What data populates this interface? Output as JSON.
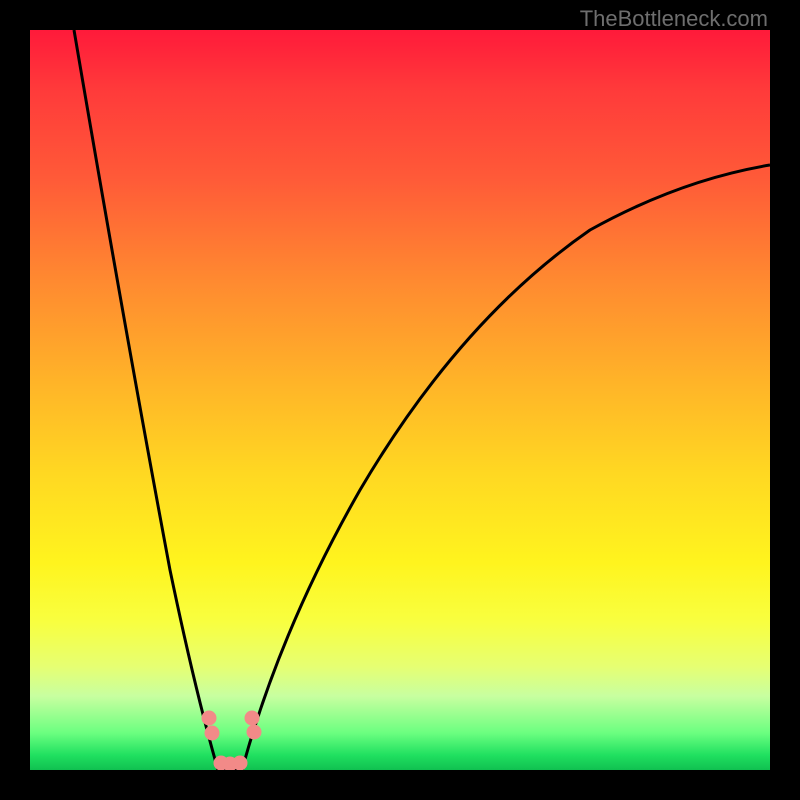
{
  "watermark": "TheBottleneck.com",
  "colors": {
    "background": "#000000",
    "gradient_top": "#ff1a3a",
    "gradient_mid": "#ffd822",
    "gradient_bottom": "#10c050",
    "curve": "#000000",
    "marker": "#f28a88"
  },
  "chart_data": {
    "type": "line",
    "title": "",
    "xlabel": "",
    "ylabel": "",
    "xlim": [
      0,
      100
    ],
    "ylim": [
      0,
      100
    ],
    "notes": "V-shaped bottleneck curve over vertical red→yellow→green gradient; minimum at roughly x≈26 touching the green band (y≈0). Left branch rises steeply to y=100 near x≈6; right branch rises with decreasing slope to y≈80 at x=100.",
    "series": [
      {
        "name": "left-branch",
        "x": [
          6,
          8,
          10,
          12,
          14,
          16,
          18,
          20,
          22,
          24,
          25.5
        ],
        "values": [
          100,
          87,
          73,
          60,
          48,
          37,
          27,
          18,
          10,
          4,
          0
        ]
      },
      {
        "name": "right-branch",
        "x": [
          28.5,
          30,
          33,
          36,
          40,
          45,
          50,
          56,
          63,
          72,
          82,
          100
        ],
        "values": [
          0,
          5,
          12,
          20,
          28,
          36,
          43,
          50,
          57,
          64,
          71,
          80
        ]
      }
    ],
    "markers": [
      {
        "x": 24.2,
        "y": 7.0
      },
      {
        "x": 24.6,
        "y": 5.0
      },
      {
        "x": 30.0,
        "y": 7.0
      },
      {
        "x": 30.3,
        "y": 5.2
      },
      {
        "x": 25.8,
        "y": 1.0
      },
      {
        "x": 27.0,
        "y": 0.8
      },
      {
        "x": 28.4,
        "y": 1.0
      }
    ]
  }
}
